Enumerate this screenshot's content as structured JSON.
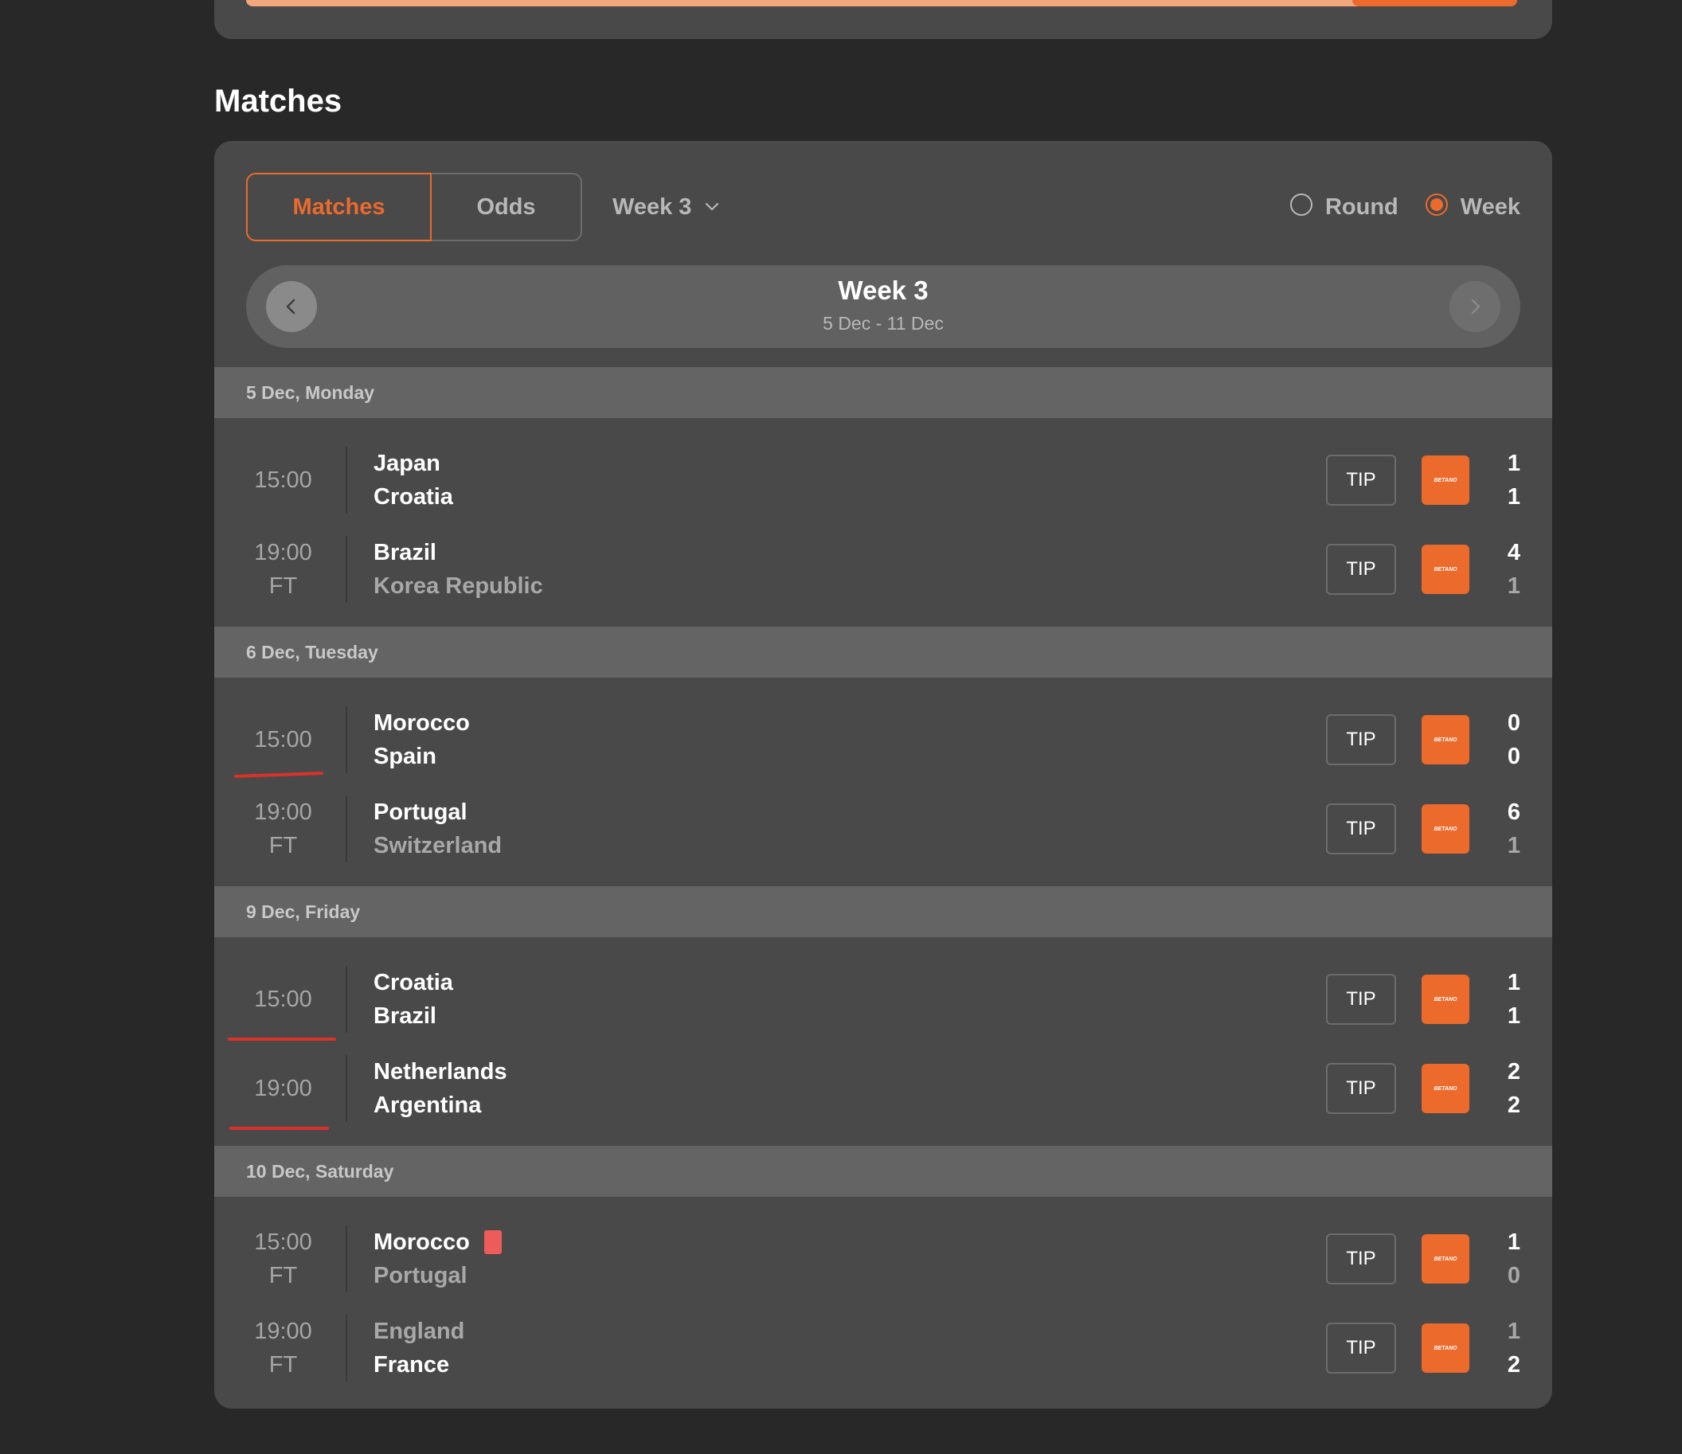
{
  "progress": {
    "fill_percent": 13
  },
  "section_title": "Matches",
  "tabs": [
    {
      "label": "Matches",
      "active": true
    },
    {
      "label": "Odds",
      "active": false
    }
  ],
  "week_dropdown": {
    "label": "Week 3"
  },
  "view_mode": {
    "options": [
      {
        "label": "Round",
        "checked": false
      },
      {
        "label": "Week",
        "checked": true
      }
    ]
  },
  "week_nav": {
    "title": "Week 3",
    "range": "5 Dec - 11 Dec"
  },
  "tip_label": "TIP",
  "bookmaker_logo_text": "BETANO",
  "colors": {
    "accent": "#eb6a2c",
    "background": "#282828",
    "card": "#494949",
    "red_card": "#ee5b5b",
    "annotation_red": "#d9322a"
  },
  "days": [
    {
      "label": "5 Dec, Monday",
      "matches": [
        {
          "time": "15:00",
          "status": "",
          "home": "Japan",
          "away": "Croatia",
          "home_score": "1",
          "away_score": "1",
          "result": "draw"
        },
        {
          "time": "19:00",
          "status": "FT",
          "home": "Brazil",
          "away": "Korea Republic",
          "home_score": "4",
          "away_score": "1",
          "result": "home"
        }
      ]
    },
    {
      "label": "6 Dec, Tuesday",
      "matches": [
        {
          "time": "15:00",
          "status": "",
          "home": "Morocco",
          "away": "Spain",
          "home_score": "0",
          "away_score": "0",
          "result": "draw"
        },
        {
          "time": "19:00",
          "status": "FT",
          "home": "Portugal",
          "away": "Switzerland",
          "home_score": "6",
          "away_score": "1",
          "result": "home"
        }
      ]
    },
    {
      "label": "9 Dec, Friday",
      "matches": [
        {
          "time": "15:00",
          "status": "",
          "home": "Croatia",
          "away": "Brazil",
          "home_score": "1",
          "away_score": "1",
          "result": "draw"
        },
        {
          "time": "19:00",
          "status": "",
          "home": "Netherlands",
          "away": "Argentina",
          "home_score": "2",
          "away_score": "2",
          "result": "draw"
        }
      ]
    },
    {
      "label": "10 Dec, Saturday",
      "matches": [
        {
          "time": "15:00",
          "status": "FT",
          "home": "Morocco",
          "away": "Portugal",
          "home_score": "1",
          "away_score": "0",
          "result": "home",
          "home_red_card": true
        },
        {
          "time": "19:00",
          "status": "FT",
          "home": "England",
          "away": "France",
          "home_score": "1",
          "away_score": "2",
          "result": "away"
        }
      ]
    }
  ]
}
